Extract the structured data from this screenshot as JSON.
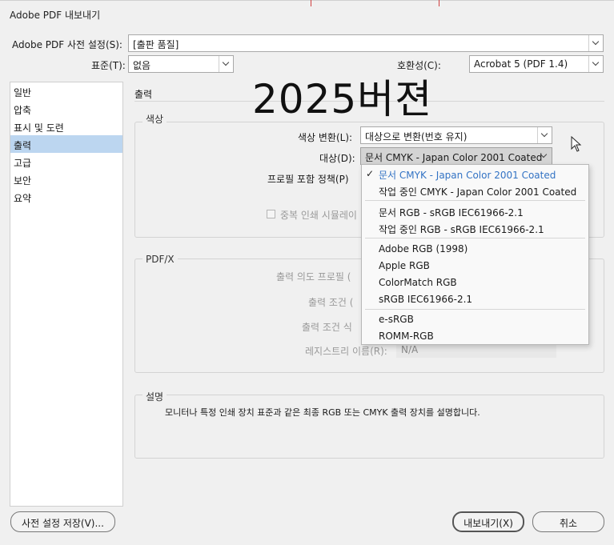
{
  "window": {
    "title": "Adobe PDF 내보내기"
  },
  "preset": {
    "label": "Adobe PDF 사전 설정(S):",
    "value": "[출판 품질]"
  },
  "standard": {
    "label": "표준(T):",
    "value": "없음"
  },
  "compat": {
    "label": "호환성(C):",
    "value": "Acrobat 5 (PDF 1.4)"
  },
  "overlay_text": "2025버젼",
  "sidebar": {
    "items": [
      {
        "label": "일반"
      },
      {
        "label": "압축"
      },
      {
        "label": "표시 및 도련"
      },
      {
        "label": "출력",
        "active": true
      },
      {
        "label": "고급"
      },
      {
        "label": "보안"
      },
      {
        "label": "요약"
      }
    ]
  },
  "output": {
    "section_title": "출력",
    "color": {
      "legend": "색상",
      "conversion_label": "색상 변환(L):",
      "conversion_value": "대상으로 변환(번호 유지)",
      "destination_label": "대상(D):",
      "destination_value": "문서 CMYK - Japan Color 2001 Coated",
      "profile_policy_label": "프로필 포함 정책(P)",
      "overprint_label": "중복 인쇄 시뮬레이"
    },
    "pdfx": {
      "legend": "PDF/X",
      "intent_label": "출력 의도 프로필 (",
      "condition_label": "출력 조건 (",
      "condition_id_label": "출력 조건 식",
      "registry_label": "레지스트리 이름(R):",
      "registry_value": "N/A"
    },
    "description": {
      "legend": "설명",
      "text": "모니터나 특정 인쇄 장치 표준과 같은 최종 RGB 또는 CMYK 출력 장치를 설명합니다."
    }
  },
  "destination_menu": {
    "groups": [
      [
        "문서 CMYK - Japan Color 2001 Coated",
        "작업 중인 CMYK - Japan Color 2001 Coated"
      ],
      [
        "문서 RGB - sRGB IEC61966-2.1",
        "작업 중인 RGB - sRGB IEC61966-2.1"
      ],
      [
        "Adobe RGB (1998)",
        "Apple RGB",
        "ColorMatch RGB",
        "sRGB IEC61966-2.1"
      ],
      [
        "e-sRGB",
        "ROMM-RGB"
      ]
    ],
    "selected": "문서 CMYK - Japan Color 2001 Coated"
  },
  "buttons": {
    "save_preset": "사전 설정 저장(V)...",
    "export": "내보내기(X)",
    "cancel": "취소"
  },
  "icons": {
    "check": "checkmark-icon",
    "cursor": "mouse-pointer-icon"
  }
}
